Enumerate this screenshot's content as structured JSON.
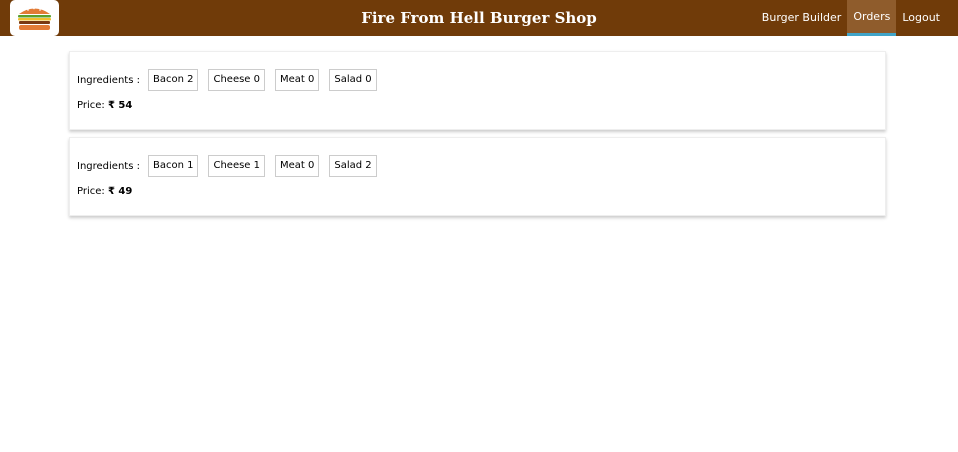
{
  "header": {
    "title": "Fire From Hell Burger Shop",
    "logo_icon": "burger-logo-icon"
  },
  "nav": {
    "items": [
      {
        "label": "Burger Builder",
        "active": false
      },
      {
        "label": "Orders",
        "active": true
      },
      {
        "label": "Logout",
        "active": false
      }
    ]
  },
  "orders": [
    {
      "ingredients_label": "Ingredients :",
      "ingredients": [
        "Bacon 2",
        "Cheese 0",
        "Meat 0",
        "Salad 0"
      ],
      "price_label": "Price:",
      "price": "₹ 54"
    },
    {
      "ingredients_label": "Ingredients :",
      "ingredients": [
        "Bacon 1",
        "Cheese 1",
        "Meat 0",
        "Salad 2"
      ],
      "price_label": "Price:",
      "price": "₹ 49"
    }
  ],
  "colors": {
    "toolbar": "#703b09",
    "active_nav": "#8f5c2c",
    "active_underline": "#40a4c8"
  }
}
